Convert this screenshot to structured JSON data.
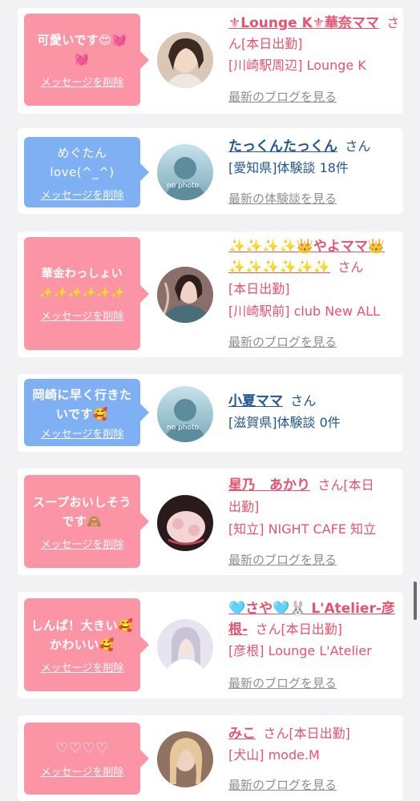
{
  "items": [
    {
      "message": "可愛いです😍💓💓",
      "delete_label": "メッセージを削除",
      "name": "⚜Lounge K⚜華奈ママ",
      "suffix": "さん[本日出勤]",
      "detail": "[川崎駅周辺] Lounge K",
      "link": "最新のブログを見る"
    },
    {
      "message": "めぐたん love(^_^)",
      "delete_label": "メッセージを削除",
      "name": "たっくんたっくん",
      "suffix": "さん",
      "detail": "[愛知県]体験談 18件",
      "link": "最新の体験談を見る",
      "avatar_text": "no photo"
    },
    {
      "message": "華金わっしょい✨✨✨✨✨✨",
      "delete_label": "メッセージを削除",
      "name": "✨✨✨✨👑やよママ👑✨✨✨✨✨✨",
      "suffix": "さん",
      "detail1": "[本日出勤]",
      "detail2": "[川崎駅前] club New ALL",
      "link": "最新のブログを見る"
    },
    {
      "message": "岡崎に早く行きたいです🥰",
      "delete_label": "メッセージを削除",
      "name": "小夏ママ",
      "suffix": "さん",
      "detail": "[滋賀県]体験談 0件",
      "avatar_text": "no photo"
    },
    {
      "message": "スープおいしそうです🙈",
      "delete_label": "メッセージを削除",
      "name": "星乃　あかり",
      "suffix": "さん[本日",
      "suffix2": "出勤]",
      "detail": "[知立] NIGHT CAFE 知立",
      "link": "最新のブログを見る"
    },
    {
      "message": "しんぱ！大きい🥰かわいい🥰",
      "delete_label": "メッセージを削除",
      "name": "🩵さや🩵🐰 L'Atelier-彦根-",
      "suffix": "さん[本日出勤]",
      "detail": "[彦根] Lounge L'Atelier",
      "link": "最新のブログを見る"
    },
    {
      "message": "♡♡♡♡",
      "delete_label": "メッセージを削除",
      "name": "みこ",
      "suffix": "さん[本日出勤]",
      "detail": "[犬山] mode.M",
      "link": "最新のブログを見る"
    }
  ],
  "colors": {
    "pink_bubble": "#fb95a6",
    "blue_bubble": "#7fb0f4",
    "pink_text": "#e5536e",
    "blue_text": "#21568e",
    "link_gray": "#8e8e8e"
  }
}
